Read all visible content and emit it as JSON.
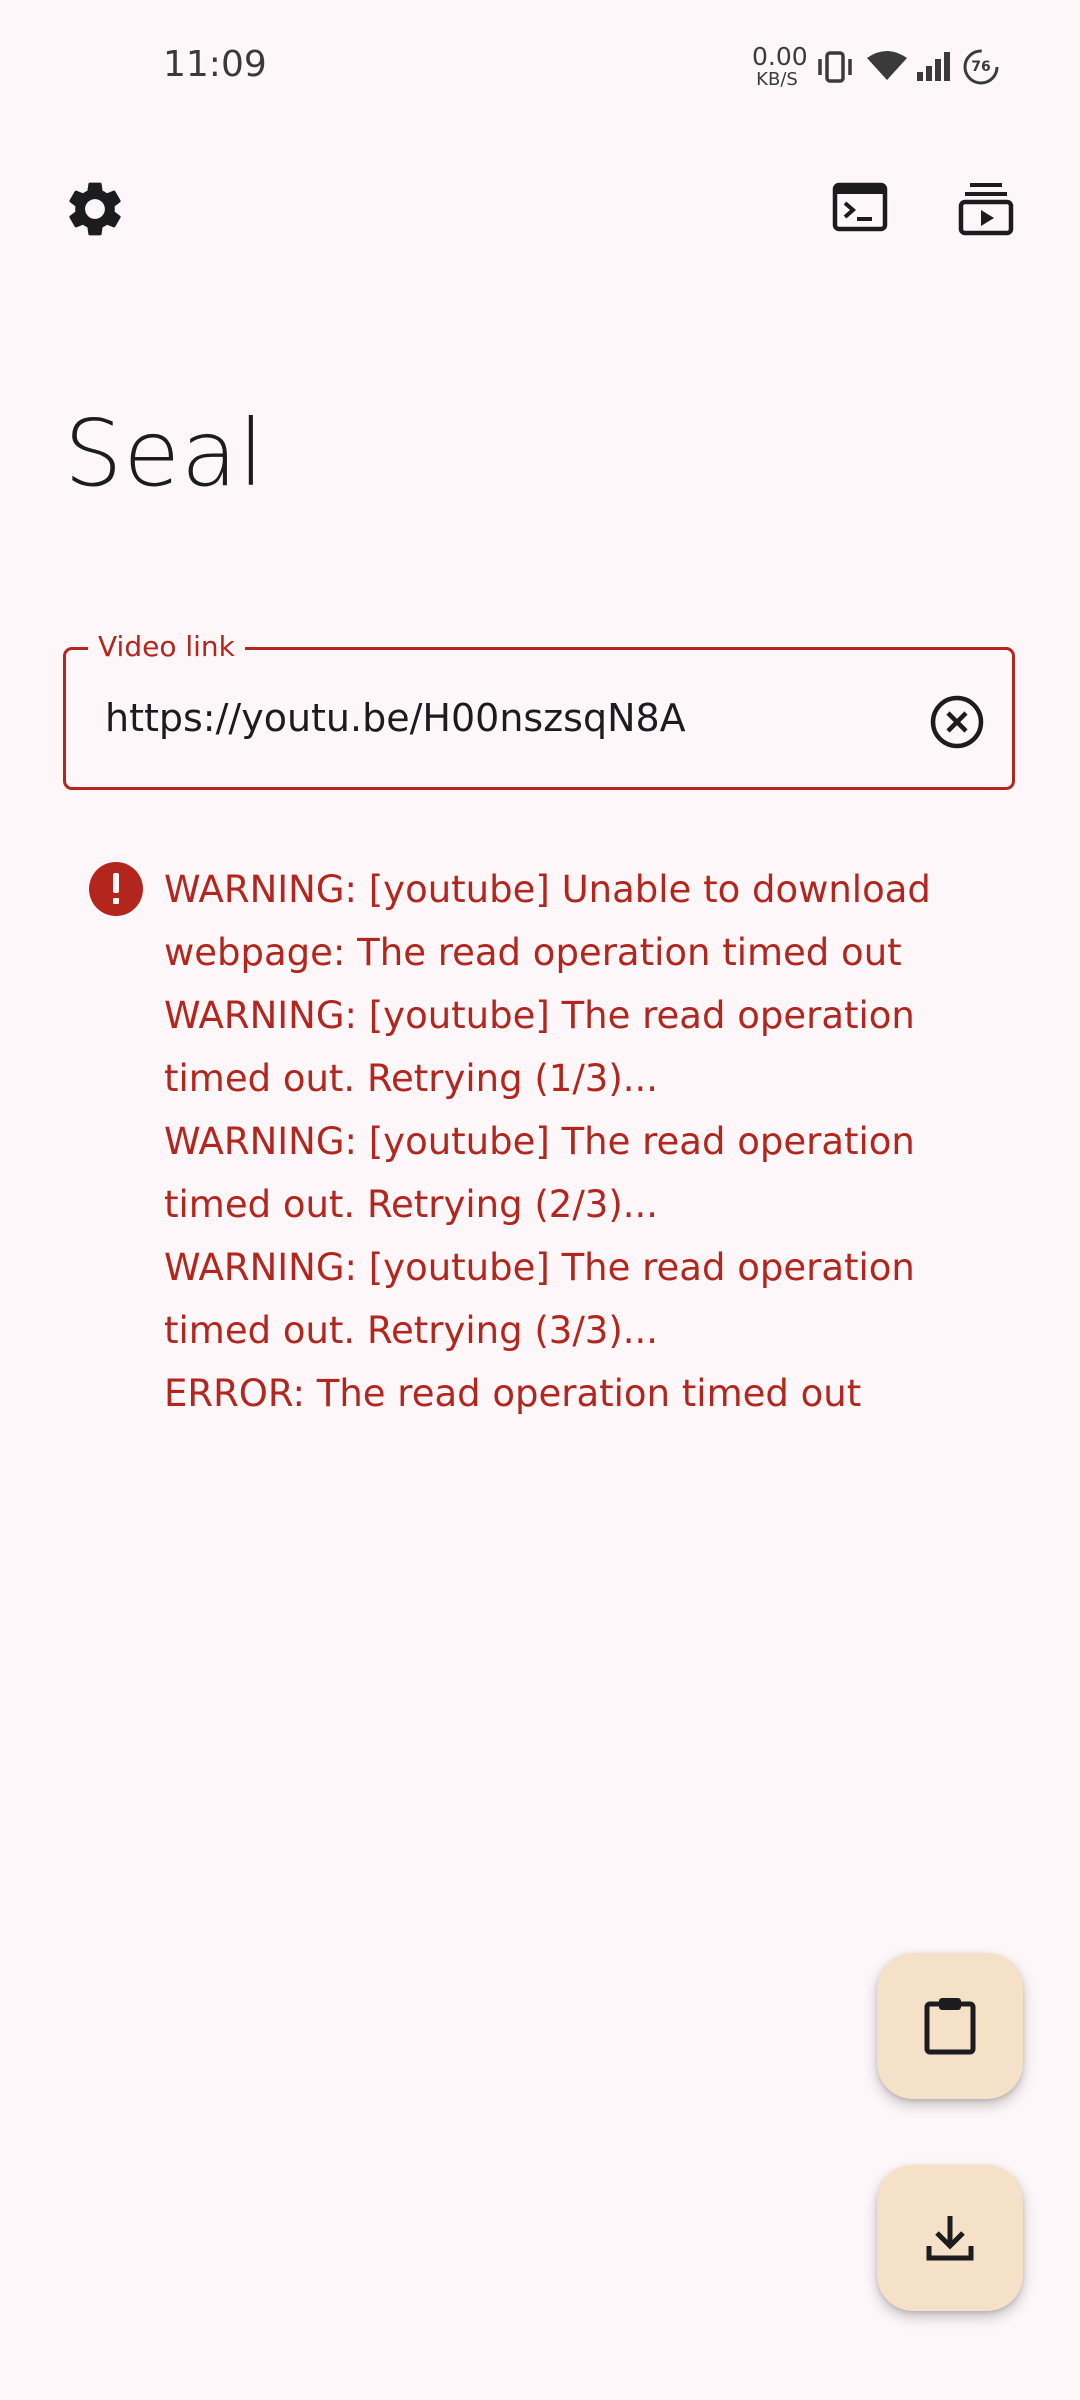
{
  "status_bar": {
    "time": "11:09",
    "net_speed_value": "0.00",
    "net_speed_unit": "KB/S",
    "battery_level": "76"
  },
  "app_bar": {
    "icons": [
      "settings-icon",
      "terminal-icon",
      "subscriptions-icon"
    ]
  },
  "main": {
    "title": "Seal",
    "video_link": {
      "label": "Video link",
      "value": "https://youtu.be/H00nszsqN8A"
    },
    "error_message": "WARNING: [youtube] Unable to download\nwebpage: The read operation timed out\nWARNING: [youtube] The read operation\ntimed out. Retrying (1/3)...\nWARNING: [youtube] The read operation\ntimed out. Retrying (2/3)...\nWARNING: [youtube] The read operation\ntimed out. Retrying (3/3)...\nERROR: The read operation timed out"
  },
  "fabs": {
    "paste_icon": "clipboard-icon",
    "download_icon": "download-icon"
  },
  "colors": {
    "background": "#fef7f9",
    "error": "#b3261e",
    "fab_container": "#f4e1c8",
    "on_surface": "#1c1b1e"
  }
}
